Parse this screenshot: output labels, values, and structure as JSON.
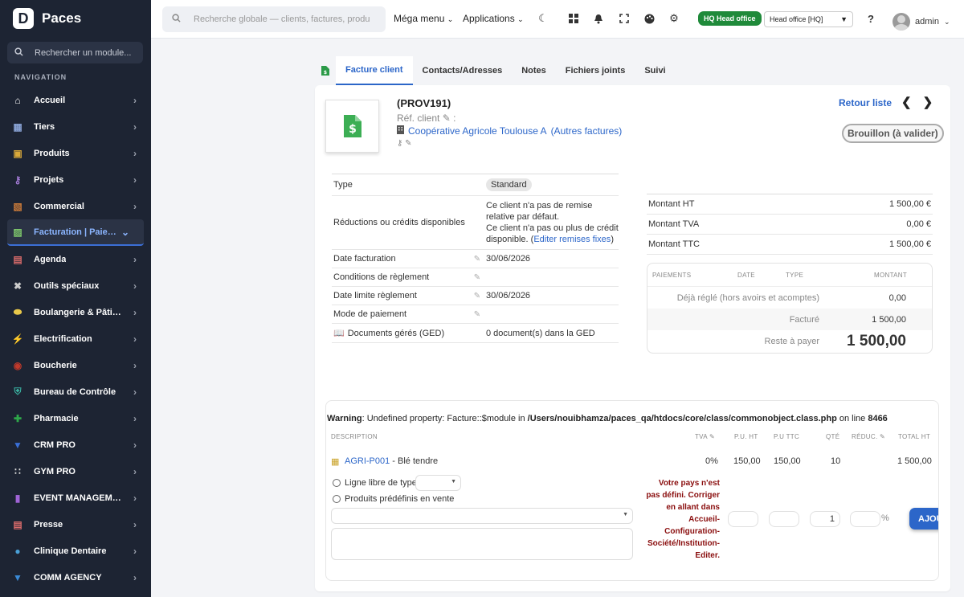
{
  "app": {
    "name": "Paces"
  },
  "sidebar": {
    "search_placeholder": "Rechercher un module...",
    "nav_title": "NAVIGATION",
    "items": [
      {
        "label": "Accueil",
        "icon": "home-icon",
        "color": "#ffffff"
      },
      {
        "label": "Tiers",
        "icon": "building-icon",
        "color": "#8aa4d6"
      },
      {
        "label": "Produits",
        "icon": "box-icon",
        "color": "#d9a93a"
      },
      {
        "label": "Projets",
        "icon": "sitemap-icon",
        "color": "#a37bd6"
      },
      {
        "label": "Commercial",
        "icon": "suitcase-icon",
        "color": "#c97a3a"
      },
      {
        "label": "Facturation | Paiement",
        "icon": "invoice-icon",
        "color": "#7cc46b"
      },
      {
        "label": "Agenda",
        "icon": "calendar-icon",
        "color": "#d66a6a"
      },
      {
        "label": "Outils spéciaux",
        "icon": "tools-icon",
        "color": "#cccccc"
      },
      {
        "label": "Boulangerie & Pâtisserie",
        "icon": "bread-icon",
        "color": "#e8c84a"
      },
      {
        "label": "Electrification",
        "icon": "bolt-icon",
        "color": "#f2c230"
      },
      {
        "label": "Boucherie",
        "icon": "meat-icon",
        "color": "#c0392b"
      },
      {
        "label": "Bureau de Contrôle",
        "icon": "shield-icon",
        "color": "#3ab0a0"
      },
      {
        "label": "Pharmacie",
        "icon": "cross-icon",
        "color": "#2ea84a"
      },
      {
        "label": "CRM PRO",
        "icon": "funnel-icon",
        "color": "#3a6fd6"
      },
      {
        "label": "GYM PRO",
        "icon": "dumbbell-icon",
        "color": "#dddddd"
      },
      {
        "label": "EVENT MANAGEMENT",
        "icon": "ticket-icon",
        "color": "#a064d6"
      },
      {
        "label": "Presse",
        "icon": "newspaper-icon",
        "color": "#d66a6a"
      },
      {
        "label": "Clinique Dentaire",
        "icon": "tooth-icon",
        "color": "#4aa0d6"
      },
      {
        "label": "COMM AGENCY",
        "icon": "megaphone-icon",
        "color": "#3a8ad6"
      }
    ]
  },
  "topbar": {
    "search_placeholder": "Recherche globale — clients, factures, produits...",
    "mega_menu": "Méga menu",
    "applications": "Applications",
    "hq_badge": "HQ Head office",
    "hq_select": "Head office [HQ]",
    "user": "admin"
  },
  "tabs": [
    {
      "label": "Facture client",
      "active": true
    },
    {
      "label": "Contacts/Adresses"
    },
    {
      "label": "Notes"
    },
    {
      "label": "Fichiers joints"
    },
    {
      "label": "Suivi"
    }
  ],
  "invoice": {
    "ref": "(PROV191)",
    "ref_client_label": "Réf. client",
    "thirdparty": "Coopérative Agricole Toulouse A",
    "thirdparty_extra": "(Autres factures)",
    "retour": "Retour liste",
    "status": "Brouillon (à valider)"
  },
  "info": {
    "type_label": "Type",
    "type_value": "Standard",
    "reductions_label": "Réductions ou crédits disponibles",
    "reductions_text1": "Ce client n'a pas de remise relative par défaut.",
    "reductions_text2": "Ce client n'a pas ou plus de crédit disponible.",
    "reductions_link": "Editer remises fixes",
    "date_label": "Date facturation",
    "date_value": "30/06/2026",
    "conditions_label": "Conditions de règlement",
    "date_limit_label": "Date limite règlement",
    "date_limit_value": "30/06/2026",
    "mode_label": "Mode de paiement",
    "ged_label": "Documents gérés (GED)",
    "ged_value": "0 document(s) dans la GED"
  },
  "amounts": {
    "ht_label": "Montant HT",
    "ht": "1 500,00 €",
    "tva_label": "Montant TVA",
    "tva": "0,00 €",
    "ttc_label": "Montant TTC",
    "ttc": "1 500,00 €"
  },
  "payments": {
    "headers": [
      "PAIEMENTS",
      "DATE",
      "TYPE",
      "MONTANT"
    ],
    "deja_label": "Déjà réglé (hors avoirs et acomptes)",
    "deja": "0,00",
    "facture_label": "Facturé",
    "facture": "1 500,00",
    "reste_label": "Reste à payer",
    "reste": "1 500,00"
  },
  "lines": {
    "warning_prefix": "Warning",
    "warning_text": ": Undefined property: Facture::$module in ",
    "warning_path": "/Users/nouibhamza/paces_qa/htdocs/core/class/commonobject.class.php",
    "warning_online": " on line ",
    "warning_line": "8466",
    "headers": {
      "desc": "DESCRIPTION",
      "tva": "TVA",
      "puht": "P.U. HT",
      "puttc": "P.U TTC",
      "qty": "QTÉ",
      "reduc": "RÉDUC.",
      "total": "TOTAL HT"
    },
    "row": {
      "ref": "AGRI-P001",
      "label": " - Blé tendre",
      "tva": "0%",
      "puht": "150,00",
      "puttc": "150,00",
      "qty": "10",
      "total": "1 500,00"
    },
    "free_line": "Ligne libre de type",
    "predef": "Produits prédéfinis en vente",
    "error_msg": "Votre pays n'est pas défini. Corriger en allant dans Accueil-Configuration-Société/Institution-Editer.",
    "qty_default": "1",
    "percent": "%",
    "add_button": "AJOUTER"
  }
}
